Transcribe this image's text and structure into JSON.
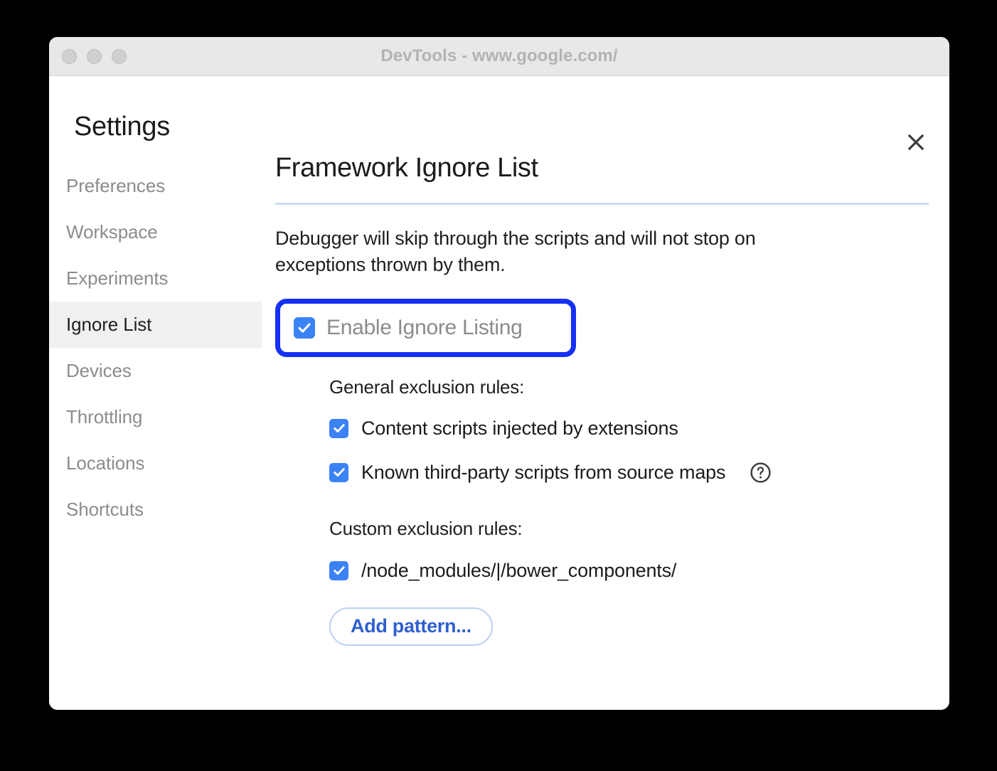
{
  "window": {
    "title": "DevTools - www.google.com/",
    "traffic_lights": [
      "close",
      "minimize",
      "zoom"
    ]
  },
  "sidebar": {
    "heading": "Settings",
    "items": [
      {
        "label": "Preferences",
        "active": false
      },
      {
        "label": "Workspace",
        "active": false
      },
      {
        "label": "Experiments",
        "active": false
      },
      {
        "label": "Ignore List",
        "active": true
      },
      {
        "label": "Devices",
        "active": false
      },
      {
        "label": "Throttling",
        "active": false
      },
      {
        "label": "Locations",
        "active": false
      },
      {
        "label": "Shortcuts",
        "active": false
      }
    ]
  },
  "main": {
    "title": "Framework Ignore List",
    "description": "Debugger will skip through the scripts and will not stop on exceptions thrown by them.",
    "close_icon": "close-icon",
    "enable_toggle": {
      "label": "Enable Ignore Listing",
      "checked": true,
      "highlighted": true
    },
    "general_rules": {
      "heading": "General exclusion rules:",
      "items": [
        {
          "label": "Content scripts injected by extensions",
          "checked": true,
          "help": false
        },
        {
          "label": "Known third-party scripts from source maps",
          "checked": true,
          "help": true
        }
      ]
    },
    "custom_rules": {
      "heading": "Custom exclusion rules:",
      "items": [
        {
          "label": "/node_modules/|/bower_components/",
          "checked": true
        }
      ]
    },
    "add_pattern_label": "Add pattern..."
  },
  "colors": {
    "highlight_ring": "#1430f5",
    "checkbox": "#3b82f6",
    "accent_link": "#2f5fd0",
    "divider": "#ccd8f3",
    "titlebar": "#e8e8e8",
    "active_nav_bg": "#f0f0f0",
    "page_background": "#000000"
  }
}
